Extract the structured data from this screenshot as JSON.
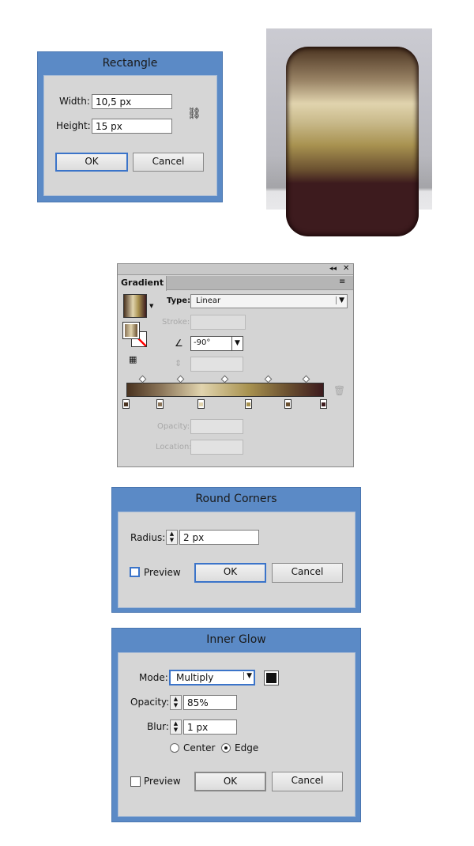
{
  "rectangle_dialog": {
    "title": "Rectangle",
    "width_label": "Width:",
    "width_value": "10,5 px",
    "height_label": "Height:",
    "height_value": "15 px",
    "ok": "OK",
    "cancel": "Cancel",
    "link_icon": "constrain-proportions-icon"
  },
  "preview": {
    "colors": {
      "top": "#4a3320",
      "highlight": "#e1d4ae",
      "mid": "#a89250",
      "dark": "#3d1b1e"
    }
  },
  "gradient_panel": {
    "tab": "Gradient",
    "type_label": "Type:",
    "type_value": "Linear",
    "stroke_label": "Stroke:",
    "angle_value": "-90°",
    "opacity_label": "Opacity:",
    "location_label": "Location:",
    "stops": [
      {
        "location": 0,
        "color": "#4a3320"
      },
      {
        "location": 17,
        "color": "#8a7458"
      },
      {
        "location": 38,
        "color": "#e1d4ae"
      },
      {
        "location": 62,
        "color": "#a89250"
      },
      {
        "location": 82,
        "color": "#6a5030"
      },
      {
        "location": 100,
        "color": "#3d1b1e"
      }
    ]
  },
  "round_corners_dialog": {
    "title": "Round Corners",
    "radius_label": "Radius:",
    "radius_value": "2 px",
    "preview_label": "Preview",
    "preview_checked": false,
    "ok": "OK",
    "cancel": "Cancel"
  },
  "inner_glow_dialog": {
    "title": "Inner Glow",
    "mode_label": "Mode:",
    "mode_value": "Multiply",
    "glow_color": "#111111",
    "opacity_label": "Opacity:",
    "opacity_value": "85%",
    "blur_label": "Blur:",
    "blur_value": "1 px",
    "center_label": "Center",
    "edge_label": "Edge",
    "selected_source": "Edge",
    "preview_label": "Preview",
    "preview_checked": false,
    "ok": "OK",
    "cancel": "Cancel"
  }
}
